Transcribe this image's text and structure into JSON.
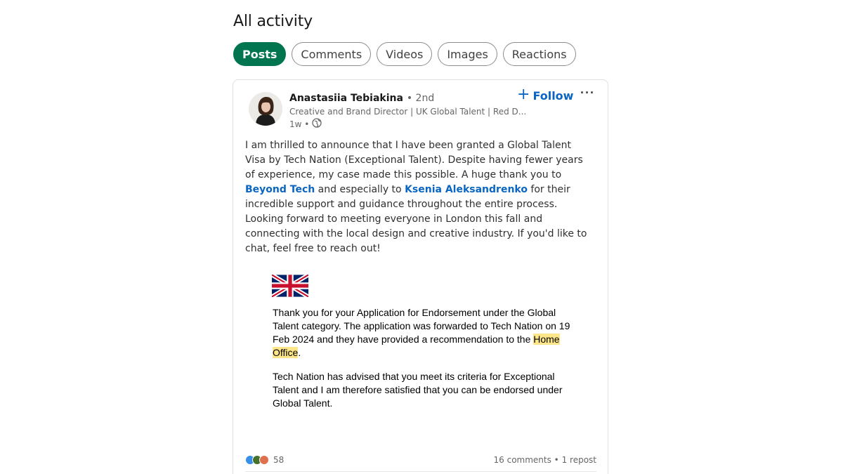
{
  "page": {
    "title": "All activity"
  },
  "tabs": [
    {
      "label": "Posts",
      "active": true
    },
    {
      "label": "Comments",
      "active": false
    },
    {
      "label": "Videos",
      "active": false
    },
    {
      "label": "Images",
      "active": false
    },
    {
      "label": "Reactions",
      "active": false
    }
  ],
  "post": {
    "author": {
      "name": "Anastasiia Tebiakina",
      "degree": "• 2nd",
      "headline": "Creative and Brand Director | UK Global Talent | Red D...",
      "time": "1w •"
    },
    "follow_label": "Follow",
    "more_label": "···",
    "body": {
      "p1": "I am thrilled to announce that I have been granted a Global Talent Visa by Tech Nation (Exceptional Talent). Despite having fewer years of experience, my case made this possible. A huge thank you to ",
      "mention1": "Beyond Tech",
      "p2": " and especially to ",
      "mention2": "Ksenia Aleksandrenko",
      "p3": " for their incredible support and guidance throughout the entire process. Looking forward to meeting everyone in London this fall and connecting with the local design and creative industry. If you'd like to chat, feel free to reach out!"
    },
    "image": {
      "para1_before": "Thank you for your Application for Endorsement under the Global Talent category. The application was forwarded to Tech Nation on 19 Feb 2024 and they have provided a recommendation to the ",
      "para1_highlight": "Home Office",
      "para1_after": ".",
      "para2": "Tech Nation has advised that you meet its criteria for Exceptional Talent and I am therefore satisfied that you can be endorsed under Global Talent."
    },
    "social": {
      "reaction_count": "58",
      "comments_reposts": "16 comments • 1 repost"
    }
  },
  "colors": {
    "accent_green": "#01754f",
    "link_blue": "#0a66c2",
    "highlight": "#fde68a"
  }
}
